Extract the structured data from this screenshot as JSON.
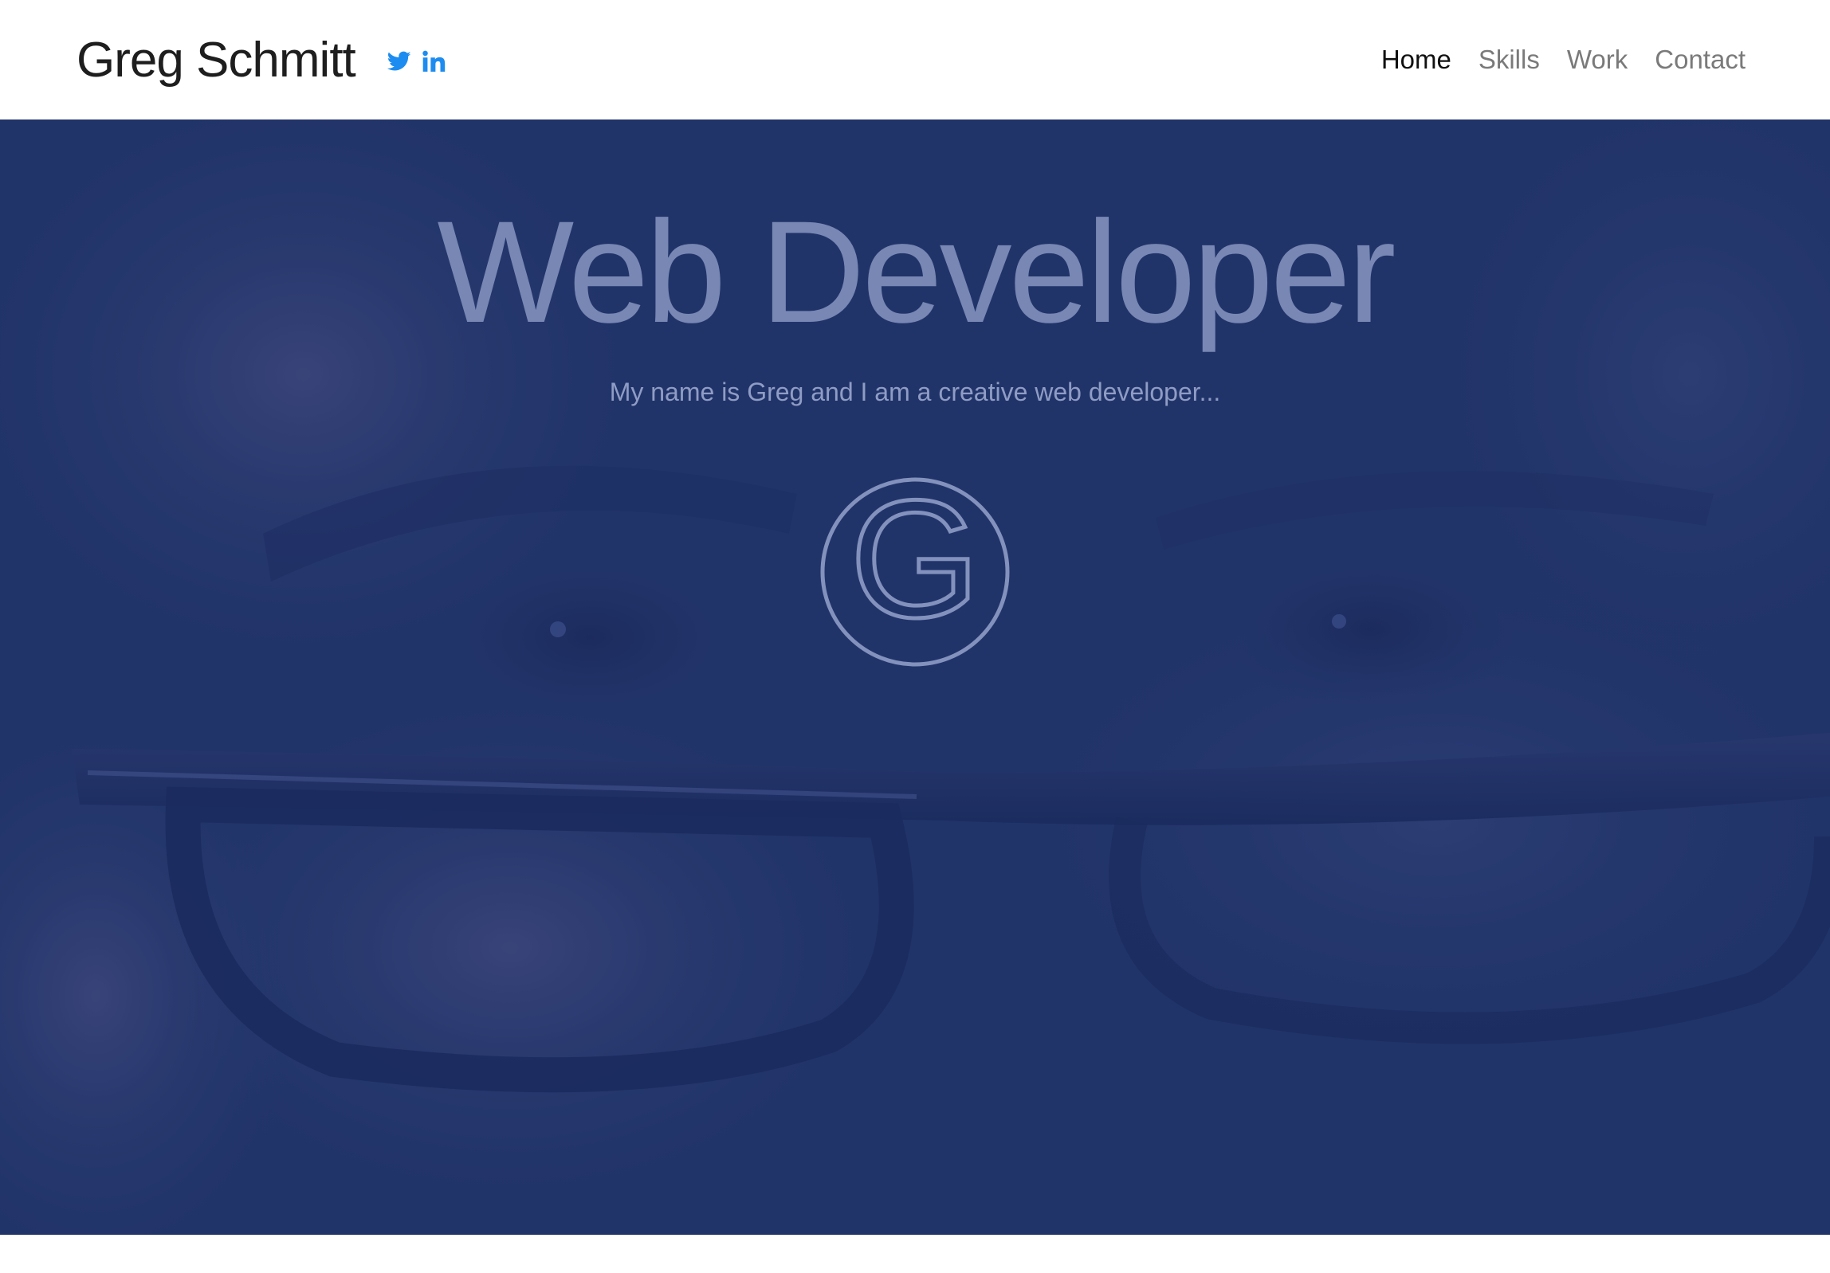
{
  "brand": {
    "name": "Greg Schmitt"
  },
  "social": [
    {
      "name": "twitter-icon",
      "color": "#1d8cf0"
    },
    {
      "name": "linkedin-icon",
      "label": "in",
      "color": "#1d8cf0"
    }
  ],
  "nav": {
    "items": [
      {
        "label": "Home",
        "active": true
      },
      {
        "label": "Skills",
        "active": false
      },
      {
        "label": "Work",
        "active": false
      },
      {
        "label": "Contact",
        "active": false
      }
    ]
  },
  "hero": {
    "title": "Web Developer",
    "subtitle": "My name is Greg and I am a creative web developer...",
    "logo_letter": "G",
    "overlay_color": "#24386c",
    "text_color": "#7887b3"
  }
}
